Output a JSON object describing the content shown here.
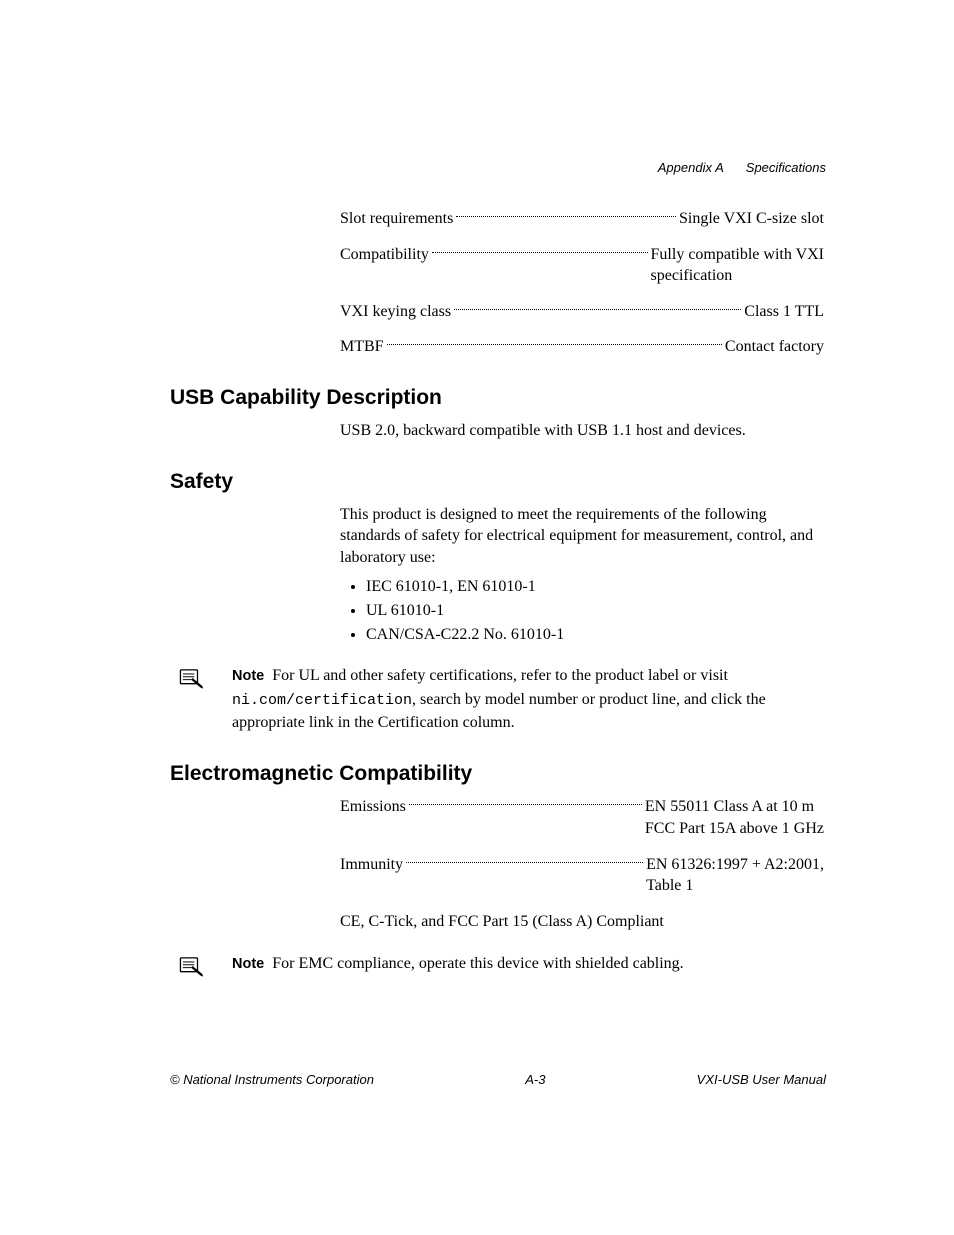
{
  "header": {
    "appendix": "Appendix A",
    "title": "Specifications"
  },
  "specs_top": [
    {
      "label": "Slot requirements",
      "value": "Single VXI C-size slot"
    },
    {
      "label": "Compatibility",
      "value": "Fully compatible with VXI",
      "value2": "specification"
    },
    {
      "label": "VXI keying class",
      "value": "Class 1 TTL"
    },
    {
      "label": "MTBF",
      "value": "Contact factory"
    }
  ],
  "sections": {
    "usb": {
      "heading": "USB Capability Description",
      "text": "USB 2.0, backward compatible with USB 1.1 host and devices."
    },
    "safety": {
      "heading": "Safety",
      "intro": "This product is designed to meet the requirements of the following standards of safety for electrical equipment for measurement, control, and laboratory use:",
      "bullets": [
        "IEC 61010-1, EN 61010-1",
        "UL 61010-1",
        "CAN/CSA-C22.2 No. 61010-1"
      ],
      "note_label": "Note",
      "note_pre": "For UL and other safety certifications, refer to the product label or visit ",
      "note_code": "ni.com/certification",
      "note_post": ", search by model number or product line, and click the appropriate link in the Certification column."
    },
    "emc": {
      "heading": "Electromagnetic Compatibility",
      "rows": [
        {
          "label": "Emissions",
          "value": "EN 55011 Class A at 10 m",
          "value2": "FCC Part 15A above 1 GHz"
        },
        {
          "label": "Immunity",
          "value": "EN 61326:1997 + A2:2001,",
          "value2": "Table 1"
        }
      ],
      "compliance": "CE, C-Tick, and FCC Part 15 (Class A) Compliant",
      "note_label": "Note",
      "note_text": "For EMC compliance, operate this device with shielded cabling."
    }
  },
  "footer": {
    "left": "© National Instruments Corporation",
    "center": "A-3",
    "right": "VXI-USB User Manual"
  }
}
